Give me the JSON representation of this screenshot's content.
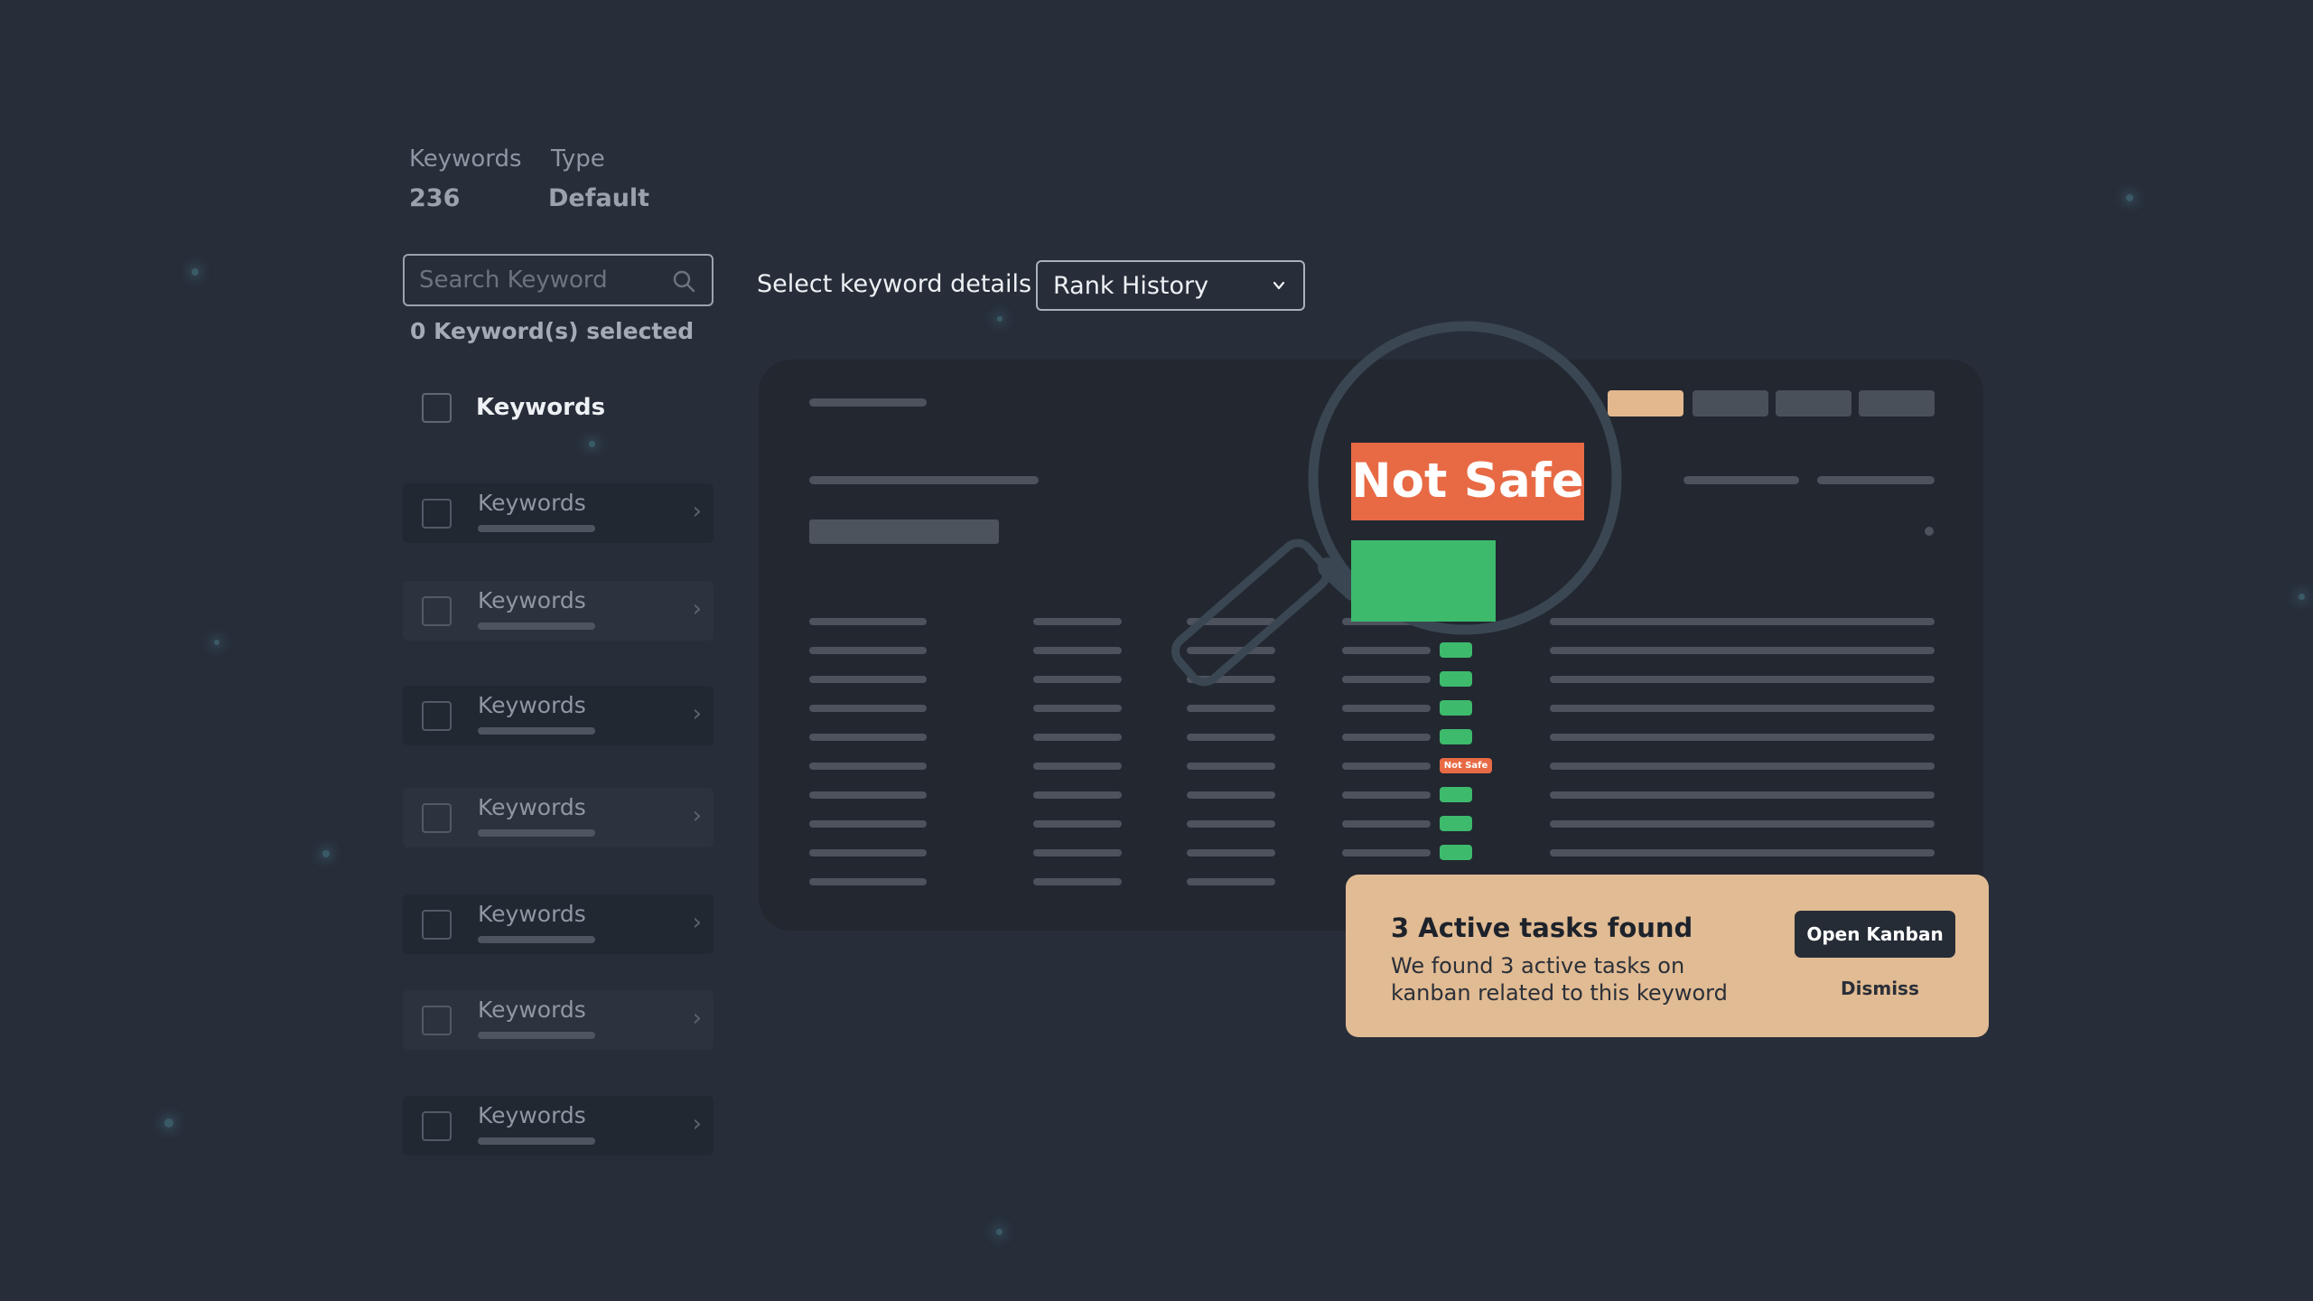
{
  "stats": {
    "keywords_label": "Keywords",
    "type_label": "Type",
    "keywords_value": "236",
    "type_value": "Default"
  },
  "search": {
    "placeholder": "Search Keyword",
    "icon": "search-icon"
  },
  "selection": {
    "count_text": "0 Keyword(s) selected"
  },
  "list": {
    "header_label": "Keywords",
    "items": [
      {
        "label": "Keywords"
      },
      {
        "label": "Keywords"
      },
      {
        "label": "Keywords"
      },
      {
        "label": "Keywords"
      },
      {
        "label": "Keywords"
      },
      {
        "label": "Keywords"
      },
      {
        "label": "Keywords"
      }
    ],
    "item_chevron": "›"
  },
  "details": {
    "select_label": "Select keyword details",
    "dropdown_value": "Rank History",
    "dropdown_icon": "chevron-down-icon"
  },
  "preview": {
    "lens_label": "Not Safe",
    "row_marks": [
      "Not Safe",
      "",
      "",
      "",
      "",
      "Not Safe",
      "",
      "",
      "",
      ""
    ],
    "colors": {
      "safe": "#3dba6c",
      "not_safe": "#e76a45",
      "active_tab": "#e3b88e"
    }
  },
  "notification": {
    "title": "3 Active tasks found",
    "body": "We found 3 active tasks on kanban related to this keyword",
    "primary_button": "Open Kanban",
    "secondary_button": "Dismiss",
    "background": "#e1bb93"
  }
}
